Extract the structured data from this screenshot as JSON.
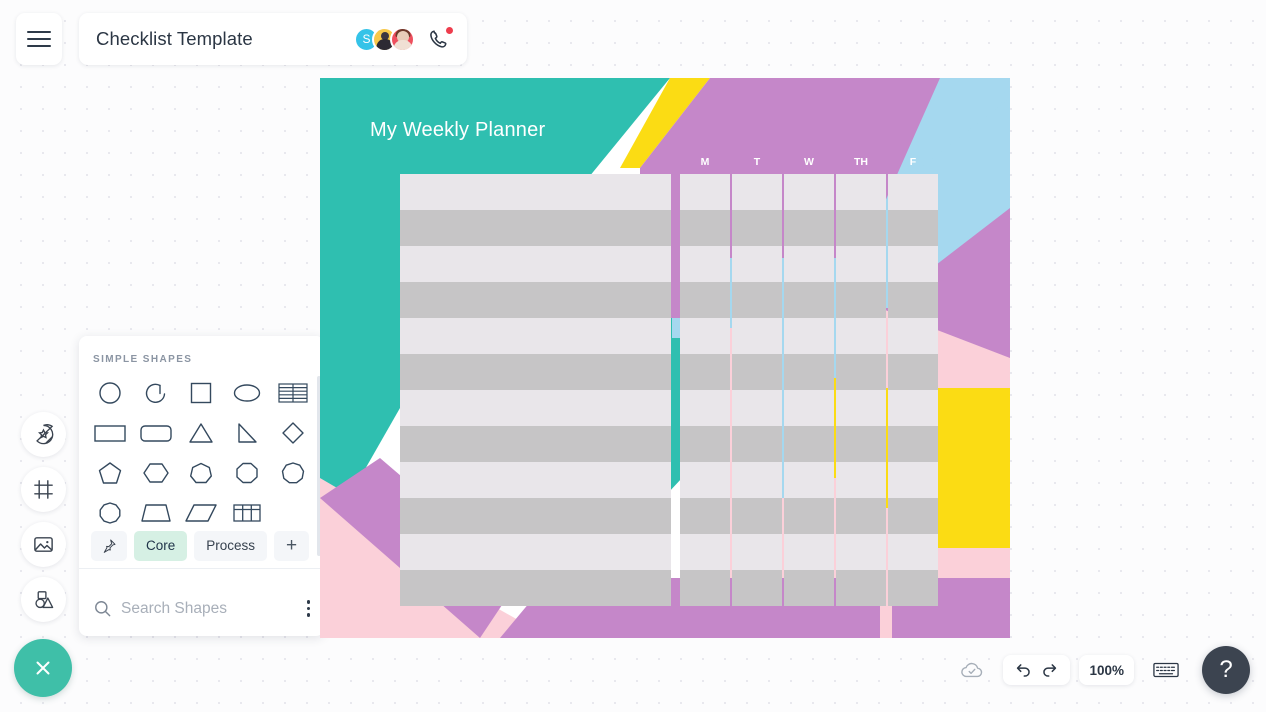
{
  "header": {
    "menu_icon": "hamburger-icon",
    "doc_title": "Checklist Template",
    "avatars": [
      {
        "name": "avatar-s",
        "initial": "S",
        "color": "#34c3e8"
      },
      {
        "name": "avatar-yellow",
        "initial": "",
        "color": "#f7c84a"
      },
      {
        "name": "avatar-red",
        "initial": "",
        "color": "#ee4f5e"
      }
    ],
    "call_icon": "phone-icon",
    "call_badge_color": "#ee3d4d"
  },
  "rail": {
    "items": [
      {
        "name": "sticker-icon",
        "label": "Stickers"
      },
      {
        "name": "frame-icon",
        "label": "Frames"
      },
      {
        "name": "image-icon",
        "label": "Images"
      },
      {
        "name": "shapes-icon",
        "label": "Shapes"
      }
    ],
    "close_icon": "close-icon",
    "close_color": "#3fbfa8"
  },
  "shapes_panel": {
    "section_title": "SIMPLE SHAPES",
    "shapes": [
      "circle-shape",
      "arc-shape",
      "square-shape",
      "ellipse-shape",
      "lined-table-shape",
      "rectangle-shape",
      "rounded-rectangle-shape",
      "triangle-shape",
      "right-triangle-shape",
      "diamond-shape",
      "pentagon-shape",
      "hexagon-shape",
      "heptagon-shape",
      "octagon-shape",
      "nonagon-shape",
      "decagon-shape",
      "trapezoid-shape",
      "parallelogram-shape",
      "grid-table-shape"
    ],
    "tabs": [
      {
        "name": "tab-pinned",
        "label": "",
        "icon": "pin-icon",
        "active": false
      },
      {
        "name": "tab-core",
        "label": "Core",
        "active": true
      },
      {
        "name": "tab-process",
        "label": "Process",
        "active": false
      },
      {
        "name": "tab-add",
        "label": "+",
        "active": false
      }
    ],
    "search_placeholder": "Search Shapes",
    "search_value": "",
    "search_icon": "search-icon",
    "more_icon": "kebab-menu-icon",
    "active_tab_color": "#d6f0e4"
  },
  "artboard": {
    "planner_title": "My Weekly Planner",
    "day_columns": [
      "M",
      "T",
      "W",
      "TH",
      "F"
    ],
    "palette": {
      "teal": "#2fbfb0",
      "purple": "#c587c9",
      "blue": "#a5d8ef",
      "pink": "#fbd0d9",
      "yellow": "#fbdc14",
      "row_light": "#e9e6ea",
      "row_dark": "#c6c5c6"
    },
    "row_count": 12,
    "task_column_label": "",
    "checkbox_columns": 5
  },
  "bottom_bar": {
    "save_status_icon": "cloud-check-icon",
    "undo_icon": "undo-icon",
    "redo_icon": "redo-icon",
    "zoom_level": "100%",
    "keyboard_icon": "keyboard-icon",
    "help_label": "?"
  }
}
